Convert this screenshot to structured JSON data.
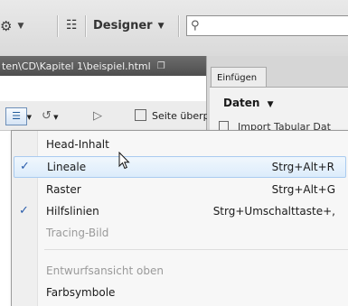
{
  "toolbar": {
    "gear_caret": "▼",
    "designer_label": "Designer",
    "designer_caret": "▼"
  },
  "path": {
    "text": "ten\\CD\\Kapitel 1\\beispiel.html"
  },
  "panel": {
    "tab_label": "Einfügen",
    "category": "Daten",
    "category_caret": "▼",
    "insert_item": "Import Tabular Dat"
  },
  "doc_toolbar": {
    "seite_label": "Seite überpr"
  },
  "menu": {
    "items": [
      {
        "label": "Head-Inhalt",
        "shortcut": "",
        "checked": false,
        "highlighted": false,
        "disabled": false
      },
      {
        "label": "Lineale",
        "shortcut": "Strg+Alt+R",
        "checked": true,
        "highlighted": true,
        "disabled": false
      },
      {
        "label": "Raster",
        "shortcut": "Strg+Alt+G",
        "checked": false,
        "highlighted": false,
        "disabled": false
      },
      {
        "label": "Hilfslinien",
        "shortcut": "Strg+Umschalttaste+,",
        "checked": true,
        "highlighted": false,
        "disabled": false
      },
      {
        "label": "Tracing-Bild",
        "shortcut": "",
        "checked": false,
        "highlighted": false,
        "disabled": true
      },
      {
        "label": "Entwurfsansicht oben",
        "shortcut": "",
        "checked": false,
        "highlighted": false,
        "disabled": true
      },
      {
        "label": "Farbsymbole",
        "shortcut": "",
        "checked": false,
        "highlighted": false,
        "disabled": false
      }
    ],
    "check_glyph": "✓"
  },
  "colors": {
    "highlight_border": "#a9cbf0",
    "check": "#2a5dab",
    "disabled_text": "#9a9a9a"
  }
}
